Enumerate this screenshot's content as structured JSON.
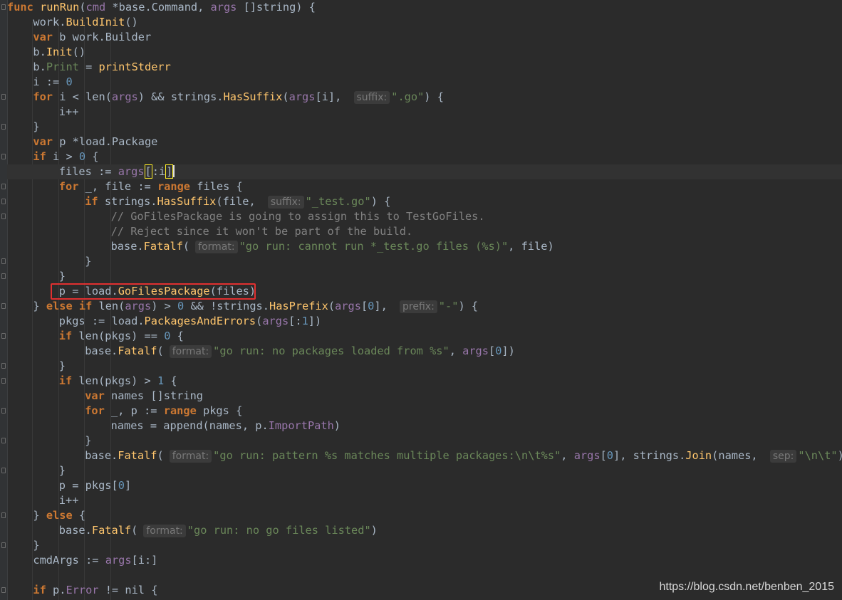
{
  "editor": {
    "lines": [
      {
        "indent": 0,
        "fold": true,
        "tokens": [
          [
            "kw",
            "func"
          ],
          [
            "t",
            " "
          ],
          [
            "fn",
            "runRun"
          ],
          [
            "t",
            "("
          ],
          [
            "pr",
            "cmd"
          ],
          [
            "t",
            " *base."
          ],
          [
            "ty",
            "Command"
          ],
          [
            "t",
            ", "
          ],
          [
            "pr",
            "args"
          ],
          [
            "t",
            " []string) {"
          ]
        ]
      },
      {
        "indent": 1,
        "tokens": [
          [
            "t",
            "work."
          ],
          [
            "fc",
            "BuildInit"
          ],
          [
            "t",
            "()"
          ]
        ]
      },
      {
        "indent": 1,
        "tokens": [
          [
            "kw",
            "var"
          ],
          [
            "t",
            " b work."
          ],
          [
            "ty",
            "Builder"
          ]
        ]
      },
      {
        "indent": 1,
        "tokens": [
          [
            "t",
            "b."
          ],
          [
            "fc",
            "Init"
          ],
          [
            "t",
            "()"
          ]
        ]
      },
      {
        "indent": 1,
        "tokens": [
          [
            "t",
            "b."
          ],
          [
            "st",
            "Print"
          ],
          [
            "t",
            " = "
          ],
          [
            "fc",
            "printStderr"
          ]
        ]
      },
      {
        "indent": 1,
        "tokens": [
          [
            "t",
            "i := "
          ],
          [
            "nu",
            "0"
          ]
        ]
      },
      {
        "indent": 1,
        "fold": true,
        "tokens": [
          [
            "kw",
            "for"
          ],
          [
            "t",
            " i < len("
          ],
          [
            "pr",
            "args"
          ],
          [
            "t",
            ") && strings."
          ],
          [
            "fc",
            "HasSuffix"
          ],
          [
            "t",
            "("
          ],
          [
            "pr",
            "args"
          ],
          [
            "t",
            "[i], "
          ],
          [
            "hint",
            "suffix:"
          ],
          [
            "st",
            "\".go\""
          ],
          [
            "t",
            ") {"
          ]
        ]
      },
      {
        "indent": 2,
        "tokens": [
          [
            "t",
            "i++"
          ]
        ]
      },
      {
        "indent": 1,
        "fold": true,
        "tokens": [
          [
            "t",
            "}"
          ]
        ]
      },
      {
        "indent": 1,
        "tokens": [
          [
            "kw",
            "var"
          ],
          [
            "t",
            " p *load."
          ],
          [
            "ty",
            "Package"
          ]
        ]
      },
      {
        "indent": 1,
        "fold": true,
        "tokens": [
          [
            "kw",
            "if"
          ],
          [
            "t",
            " i > "
          ],
          [
            "nu",
            "0"
          ],
          [
            "t",
            " {"
          ]
        ]
      },
      {
        "indent": 2,
        "cur": true,
        "tokens": [
          [
            "df",
            "files"
          ],
          [
            "t",
            " := "
          ],
          [
            "pr",
            "args"
          ],
          [
            "bh",
            "["
          ],
          [
            "t",
            ":i"
          ],
          [
            "bh",
            "]"
          ],
          [
            "cursor",
            ""
          ]
        ]
      },
      {
        "indent": 2,
        "fold": true,
        "tokens": [
          [
            "kw",
            "for"
          ],
          [
            "t",
            " _, "
          ],
          [
            "df",
            "file"
          ],
          [
            "t",
            " := "
          ],
          [
            "kw",
            "range"
          ],
          [
            "t",
            " "
          ],
          [
            "df",
            "files"
          ],
          [
            "t",
            " {"
          ]
        ]
      },
      {
        "indent": 3,
        "fold": true,
        "tokens": [
          [
            "kw",
            "if"
          ],
          [
            "t",
            " strings."
          ],
          [
            "fc",
            "HasSuffix"
          ],
          [
            "t",
            "("
          ],
          [
            "df",
            "file"
          ],
          [
            "t",
            ", "
          ],
          [
            "hint",
            "suffix:"
          ],
          [
            "st",
            "\"_test.go\""
          ],
          [
            "t",
            ") {"
          ]
        ]
      },
      {
        "indent": 4,
        "fold": true,
        "tokens": [
          [
            "cm",
            "// GoFilesPackage is going to assign this to TestGoFiles."
          ]
        ]
      },
      {
        "indent": 4,
        "tokens": [
          [
            "cm",
            "// Reject since it won't be part of the build."
          ]
        ]
      },
      {
        "indent": 4,
        "tokens": [
          [
            "t",
            "base."
          ],
          [
            "fc",
            "Fatalf"
          ],
          [
            "t",
            "("
          ],
          [
            "hint",
            "format:"
          ],
          [
            "st",
            "\"go run: cannot run *_test.go files (%s)\""
          ],
          [
            "t",
            ", "
          ],
          [
            "df",
            "file"
          ],
          [
            "t",
            ")"
          ]
        ]
      },
      {
        "indent": 3,
        "fold": true,
        "tokens": [
          [
            "t",
            "}"
          ]
        ]
      },
      {
        "indent": 2,
        "fold": true,
        "tokens": [
          [
            "t",
            "}"
          ]
        ]
      },
      {
        "indent": 2,
        "tokens": [
          [
            "t",
            "p = load."
          ],
          [
            "fc",
            "GoFilesPackage"
          ],
          [
            "t",
            "("
          ],
          [
            "df",
            "files"
          ],
          [
            "t",
            ")"
          ]
        ]
      },
      {
        "indent": 1,
        "fold": true,
        "tokens": [
          [
            "t",
            "} "
          ],
          [
            "kw",
            "else if"
          ],
          [
            "t",
            " len("
          ],
          [
            "pr",
            "args"
          ],
          [
            "t",
            ") > "
          ],
          [
            "nu",
            "0"
          ],
          [
            "t",
            " && !strings."
          ],
          [
            "fc",
            "HasPrefix"
          ],
          [
            "t",
            "("
          ],
          [
            "pr",
            "args"
          ],
          [
            "t",
            "["
          ],
          [
            "nu",
            "0"
          ],
          [
            "t",
            "], "
          ],
          [
            "hint",
            "prefix:"
          ],
          [
            "st",
            "\"-\""
          ],
          [
            "t",
            ") {"
          ]
        ]
      },
      {
        "indent": 2,
        "tokens": [
          [
            "df",
            "pkgs"
          ],
          [
            "t",
            " := load."
          ],
          [
            "fc",
            "PackagesAndErrors"
          ],
          [
            "t",
            "("
          ],
          [
            "pr",
            "args"
          ],
          [
            "t",
            "[:"
          ],
          [
            "nu",
            "1"
          ],
          [
            "t",
            "])"
          ]
        ]
      },
      {
        "indent": 2,
        "fold": true,
        "tokens": [
          [
            "kw",
            "if"
          ],
          [
            "t",
            " len("
          ],
          [
            "df",
            "pkgs"
          ],
          [
            "t",
            ") == "
          ],
          [
            "nu",
            "0"
          ],
          [
            "t",
            " {"
          ]
        ]
      },
      {
        "indent": 3,
        "tokens": [
          [
            "t",
            "base."
          ],
          [
            "fc",
            "Fatalf"
          ],
          [
            "t",
            "("
          ],
          [
            "hint",
            "format:"
          ],
          [
            "st",
            "\"go run: no packages loaded from %s\""
          ],
          [
            "t",
            ", "
          ],
          [
            "pr",
            "args"
          ],
          [
            "t",
            "["
          ],
          [
            "nu",
            "0"
          ],
          [
            "t",
            "])"
          ]
        ]
      },
      {
        "indent": 2,
        "fold": true,
        "tokens": [
          [
            "t",
            "}"
          ]
        ]
      },
      {
        "indent": 2,
        "fold": true,
        "tokens": [
          [
            "kw",
            "if"
          ],
          [
            "t",
            " len("
          ],
          [
            "df",
            "pkgs"
          ],
          [
            "t",
            ") > "
          ],
          [
            "nu",
            "1"
          ],
          [
            "t",
            " {"
          ]
        ]
      },
      {
        "indent": 3,
        "tokens": [
          [
            "kw",
            "var"
          ],
          [
            "t",
            " "
          ],
          [
            "df",
            "names"
          ],
          [
            "t",
            " []string"
          ]
        ]
      },
      {
        "indent": 3,
        "fold": true,
        "tokens": [
          [
            "kw",
            "for"
          ],
          [
            "t",
            " _, "
          ],
          [
            "df",
            "p"
          ],
          [
            "t",
            " := "
          ],
          [
            "kw",
            "range"
          ],
          [
            "t",
            " "
          ],
          [
            "df",
            "pkgs"
          ],
          [
            "t",
            " {"
          ]
        ]
      },
      {
        "indent": 4,
        "tokens": [
          [
            "df",
            "names"
          ],
          [
            "t",
            " = append("
          ],
          [
            "df",
            "names"
          ],
          [
            "t",
            ", "
          ],
          [
            "df",
            "p"
          ],
          [
            "t",
            "."
          ],
          [
            "pr",
            "ImportPath"
          ],
          [
            "t",
            ")"
          ]
        ]
      },
      {
        "indent": 3,
        "fold": true,
        "tokens": [
          [
            "t",
            "}"
          ]
        ]
      },
      {
        "indent": 3,
        "tokens": [
          [
            "t",
            "base."
          ],
          [
            "fc",
            "Fatalf"
          ],
          [
            "t",
            "("
          ],
          [
            "hint",
            "format:"
          ],
          [
            "st",
            "\"go run: pattern %s matches multiple packages:\\n\\t%s\""
          ],
          [
            "t",
            ", "
          ],
          [
            "pr",
            "args"
          ],
          [
            "t",
            "["
          ],
          [
            "nu",
            "0"
          ],
          [
            "t",
            "], strings."
          ],
          [
            "fc",
            "Join"
          ],
          [
            "t",
            "("
          ],
          [
            "df",
            "names"
          ],
          [
            "t",
            ", "
          ],
          [
            "hint",
            "sep:"
          ],
          [
            "st",
            "\"\\n\\t\""
          ],
          [
            "t",
            "))"
          ]
        ]
      },
      {
        "indent": 2,
        "fold": true,
        "tokens": [
          [
            "t",
            "}"
          ]
        ]
      },
      {
        "indent": 2,
        "tokens": [
          [
            "df",
            "p"
          ],
          [
            "t",
            " = "
          ],
          [
            "df",
            "pkgs"
          ],
          [
            "t",
            "["
          ],
          [
            "nu",
            "0"
          ],
          [
            "t",
            "]"
          ]
        ]
      },
      {
        "indent": 2,
        "tokens": [
          [
            "t",
            "i++"
          ]
        ]
      },
      {
        "indent": 1,
        "fold": true,
        "tokens": [
          [
            "t",
            "} "
          ],
          [
            "kw",
            "else"
          ],
          [
            "t",
            " {"
          ]
        ]
      },
      {
        "indent": 2,
        "tokens": [
          [
            "t",
            "base."
          ],
          [
            "fc",
            "Fatalf"
          ],
          [
            "t",
            "("
          ],
          [
            "hint",
            "format:"
          ],
          [
            "st",
            "\"go run: no go files listed\""
          ],
          [
            "t",
            ")"
          ]
        ]
      },
      {
        "indent": 1,
        "fold": true,
        "tokens": [
          [
            "t",
            "}"
          ]
        ]
      },
      {
        "indent": 1,
        "tokens": [
          [
            "df",
            "cmdArgs"
          ],
          [
            "t",
            " := "
          ],
          [
            "pr",
            "args"
          ],
          [
            "t",
            "[i:]"
          ]
        ]
      },
      {
        "indent": 1,
        "tokens": []
      },
      {
        "indent": 1,
        "fold": true,
        "tokens": [
          [
            "kw",
            "if"
          ],
          [
            "t",
            " p."
          ],
          [
            "pr",
            "Error"
          ],
          [
            "t",
            " != nil {"
          ]
        ]
      }
    ]
  },
  "watermark": "https://blog.csdn.net/benben_2015"
}
